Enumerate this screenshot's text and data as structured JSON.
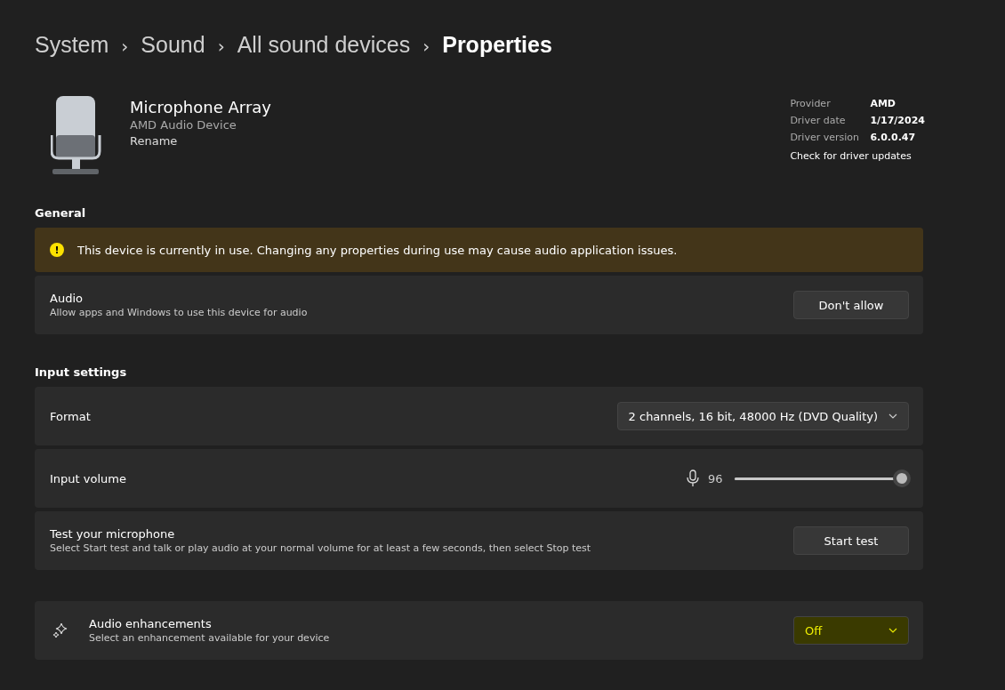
{
  "breadcrumb": [
    {
      "label": "System",
      "current": false
    },
    {
      "label": "Sound",
      "current": false
    },
    {
      "label": "All sound devices",
      "current": false
    },
    {
      "label": "Properties",
      "current": true
    }
  ],
  "breadcrumb_separator": "›",
  "device": {
    "name": "Microphone Array",
    "description": "AMD Audio Device",
    "rename": "Rename"
  },
  "driver_info": [
    {
      "label": "Provider",
      "value": "AMD"
    },
    {
      "label": "Driver date",
      "value": "1/17/2024"
    },
    {
      "label": "Driver version",
      "value": "6.0.0.47"
    }
  ],
  "driver_link": "Check for driver updates",
  "general": {
    "heading": "General",
    "warning": "This device is currently in use. Changing any properties during use may cause audio application issues.",
    "warning_glyph": "!",
    "audio": {
      "title": "Audio",
      "subtitle": "Allow apps and Windows to use this device for audio",
      "button": "Don't allow"
    }
  },
  "input_settings": {
    "heading": "Input settings",
    "rows": [
      {
        "kind": "dropdown",
        "title": "Format",
        "value": "2 channels, 16 bit, 48000 Hz (DVD Quality)"
      },
      {
        "kind": "slider",
        "title": "Input volume",
        "reading": "96",
        "level": 0.96
      },
      {
        "kind": "button",
        "title": "Test your microphone",
        "subtitle": "Select Start test and talk or play audio at your normal volume for at least a few seconds, then select Stop test",
        "button": "Start test"
      }
    ]
  },
  "enhancements": {
    "title": "Audio enhancements",
    "subtitle": "Select an enhancement available for your device",
    "value": "Off"
  }
}
